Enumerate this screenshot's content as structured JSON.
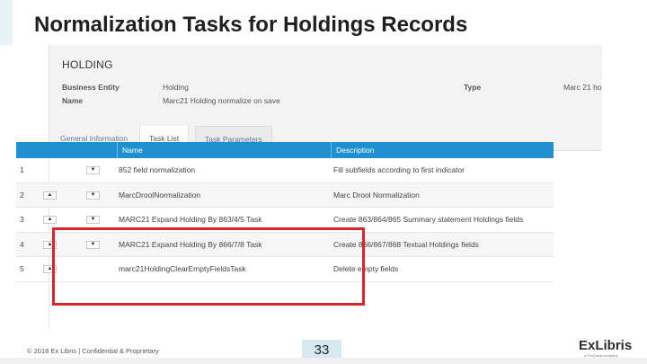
{
  "slide": {
    "title": "Normalization Tasks for Holdings Records",
    "footer": "© 2018 Ex Libris | Confidential & Proprietary",
    "page_number": "33",
    "logo": "ExLibris",
    "logo_tagline": "a ProQuest company"
  },
  "screenshot": {
    "section_title": "HOLDING",
    "fields": {
      "business_entity_label": "Business Entity",
      "business_entity_value": "Holding",
      "name_label": "Name",
      "name_value": "Marc21 Holding normalize on save",
      "type_label": "Type",
      "type_value": "Marc 21 ho"
    },
    "tabs": [
      "General Information",
      "Task List",
      "Task Parameters"
    ],
    "active_tab": "Task List",
    "table": {
      "headers": [
        "Name",
        "Description"
      ],
      "rows": [
        {
          "num": "1",
          "name": "852 field normalization",
          "description": "Fill subfields according to first indicator",
          "up": false,
          "down": true
        },
        {
          "num": "2",
          "name": "MarcDroolNormalization",
          "description": "Marc Drool Normalization",
          "up": true,
          "down": true
        },
        {
          "num": "3",
          "name": "MARC21 Expand Holding By 863/4/5 Task",
          "description": "Create 863/864/865 Summary statement Holdings fields",
          "up": true,
          "down": true
        },
        {
          "num": "4",
          "name": "MARC21 Expand Holding By 866/7/8 Task",
          "description": "Create 866/867/868 Textual Holdings fields",
          "up": true,
          "down": true
        },
        {
          "num": "5",
          "name": "marc21HoldingClearEmptyFieldsTask",
          "description": "Delete empty fields",
          "up": true,
          "down": false
        }
      ]
    }
  },
  "colors": {
    "table_header": "#1e8fcf",
    "highlight_border": "#d9242b",
    "page_number_bg": "#d7e9f0"
  },
  "icons": {
    "up": "▲",
    "down": "▼"
  }
}
